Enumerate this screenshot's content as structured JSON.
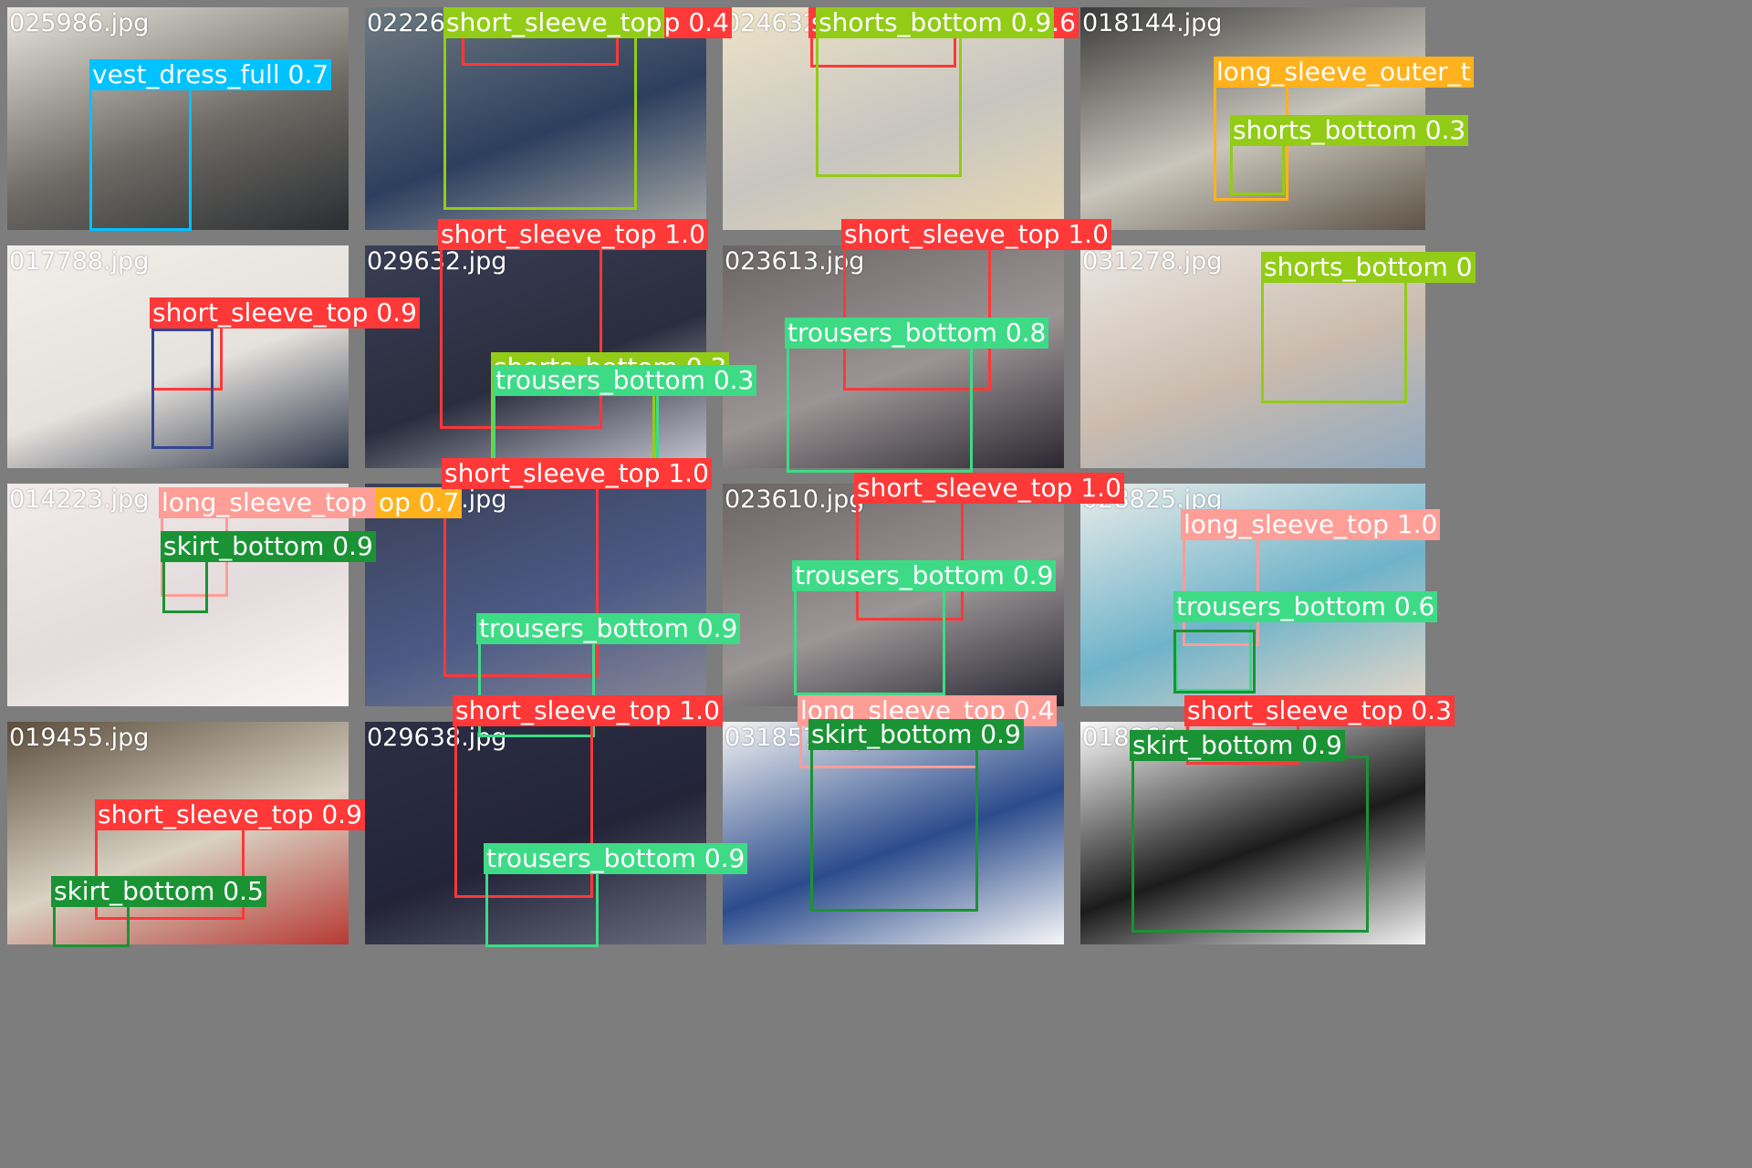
{
  "colors": {
    "short_sleeve_top": "#ff3838",
    "long_sleeve_top": "#ff9d97",
    "long_sleeve_outwear": "#ffb21d",
    "vest_dress": "#00c2ff",
    "shorts": "#92cc17",
    "trousers": "#3ddb86",
    "skirt": "#1a9334",
    "sling_dress": "#344593",
    "background": "#7d7d7d"
  },
  "tiles": [
    {
      "filename": "025986.jpg",
      "photo_colors": [
        "#e9e6df",
        "#6f6b66",
        "#2a2e32"
      ],
      "detections": [
        {
          "label": "vest_dress_full 0.7",
          "cls": "vest_dress"
        }
      ]
    },
    {
      "filename": "022262.jpg",
      "photo_colors": [
        "#6f7a80",
        "#2d3f5f",
        "#a7aaa8"
      ],
      "detections": [
        {
          "label": "short_sleeve_top 0.4",
          "cls": "short_sleeve_top"
        },
        {
          "label": "short_sleeve_top",
          "cls": "shorts"
        }
      ]
    },
    {
      "filename": "024632.jpg",
      "photo_colors": [
        "#efe3c8",
        "#c7c5c0",
        "#e8d9b4"
      ],
      "detections": [
        {
          "label": "short_sleeve_top 0.6",
          "cls": "short_sleeve_top"
        },
        {
          "label": "shorts_bottom 0.9",
          "cls": "shorts"
        }
      ]
    },
    {
      "filename": "018144.jpg",
      "photo_colors": [
        "#3a3a3a",
        "#c9c6bc",
        "#5d5245"
      ],
      "detections": [
        {
          "label": "long_sleeve_outer_t",
          "cls": "long_sleeve_outwear"
        },
        {
          "label": "shorts_bottom 0.3",
          "cls": "shorts"
        }
      ]
    },
    {
      "filename": "017788.jpg",
      "photo_colors": [
        "#f1efeb",
        "#e5e1dc",
        "#2c3548"
      ],
      "detections": [
        {
          "label": "short_sleeve_top 0.9",
          "cls": "short_sleeve_top"
        },
        {
          "label": "",
          "cls": "sling_dress"
        }
      ]
    },
    {
      "filename": "029632.jpg",
      "photo_colors": [
        "#3a3e56",
        "#2a2d3d",
        "#c9c9d4"
      ],
      "detections": [
        {
          "label": "short_sleeve_top 1.0",
          "cls": "short_sleeve_top"
        },
        {
          "label": "shorts_bottom 0.3",
          "cls": "shorts"
        },
        {
          "label": "trousers_bottom 0.3",
          "cls": "trousers"
        }
      ]
    },
    {
      "filename": "023613.jpg",
      "photo_colors": [
        "#6a6465",
        "#9a9494",
        "#2b2730"
      ],
      "detections": [
        {
          "label": "short_sleeve_top 1.0",
          "cls": "short_sleeve_top"
        },
        {
          "label": "trousers_bottom 0.8",
          "cls": "trousers"
        }
      ]
    },
    {
      "filename": "031278.jpg",
      "photo_colors": [
        "#ece7e2",
        "#cabbae",
        "#8fa9c0"
      ],
      "detections": [
        {
          "label": "shorts_bottom 0",
          "cls": "shorts"
        }
      ]
    },
    {
      "filename": "014223.jpg",
      "photo_colors": [
        "#f1ebeb",
        "#e4dcdc",
        "#fbf6f5"
      ],
      "detections": [
        {
          "label": "long_sleeve_top 0.6",
          "cls": "long_sleeve_top"
        },
        {
          "label": "op 0.7",
          "cls": "long_sleeve_outwear"
        },
        {
          "label": "skirt_bottom 0.9",
          "cls": "skirt"
        }
      ]
    },
    {
      "filename": "029637.jpg",
      "photo_colors": [
        "#3b3f57",
        "#4b5a85",
        "#8a8896"
      ],
      "detections": [
        {
          "label": "short_sleeve_top 1.0",
          "cls": "short_sleeve_top"
        },
        {
          "label": "trousers_bottom 0.9",
          "cls": "trousers"
        }
      ]
    },
    {
      "filename": "023610.jpg",
      "photo_colors": [
        "#6a6465",
        "#9b9595",
        "#23232f"
      ],
      "detections": [
        {
          "label": "short_sleeve_top 1.0",
          "cls": "short_sleeve_top"
        },
        {
          "label": "trousers_bottom 0.9",
          "cls": "trousers"
        }
      ]
    },
    {
      "filename": "028825.jpg",
      "photo_colors": [
        "#eaecea",
        "#6fb3c9",
        "#e8d8c9"
      ],
      "detections": [
        {
          "label": "long_sleeve_top 1.0",
          "cls": "long_sleeve_top"
        },
        {
          "label": "trousers_bottom 0.6",
          "cls": "trousers"
        },
        {
          "label": "",
          "cls": "skirt"
        }
      ]
    },
    {
      "filename": "019455.jpg",
      "photo_colors": [
        "#5b4d3c",
        "#d9d2c3",
        "#b73a34"
      ],
      "detections": [
        {
          "label": "short_sleeve_top 0.9",
          "cls": "short_sleeve_top"
        },
        {
          "label": "skirt_bottom 0.5",
          "cls": "skirt"
        }
      ]
    },
    {
      "filename": "029638.jpg",
      "photo_colors": [
        "#2c2f45",
        "#232438",
        "#6a6c80"
      ],
      "detections": [
        {
          "label": "short_sleeve_top 1.0",
          "cls": "short_sleeve_top"
        },
        {
          "label": "trousers_bottom 0.9",
          "cls": "trousers"
        }
      ]
    },
    {
      "filename": "031857.jpg",
      "photo_colors": [
        "#f2f2f3",
        "#2b4c8c",
        "#f7f7f8"
      ],
      "detections": [
        {
          "label": "long_sleeve_top 0.4",
          "cls": "long_sleeve_top"
        },
        {
          "label": "skirt_bottom 0.9",
          "cls": "skirt"
        }
      ]
    },
    {
      "filename": "018866.jpg",
      "photo_colors": [
        "#fbfbfb",
        "#1b1b1b",
        "#f4f4f4"
      ],
      "detections": [
        {
          "label": "short_sleeve_top 0.3",
          "cls": "short_sleeve_top"
        },
        {
          "label": "skirt_bottom 0.9",
          "cls": "skirt"
        }
      ]
    }
  ]
}
